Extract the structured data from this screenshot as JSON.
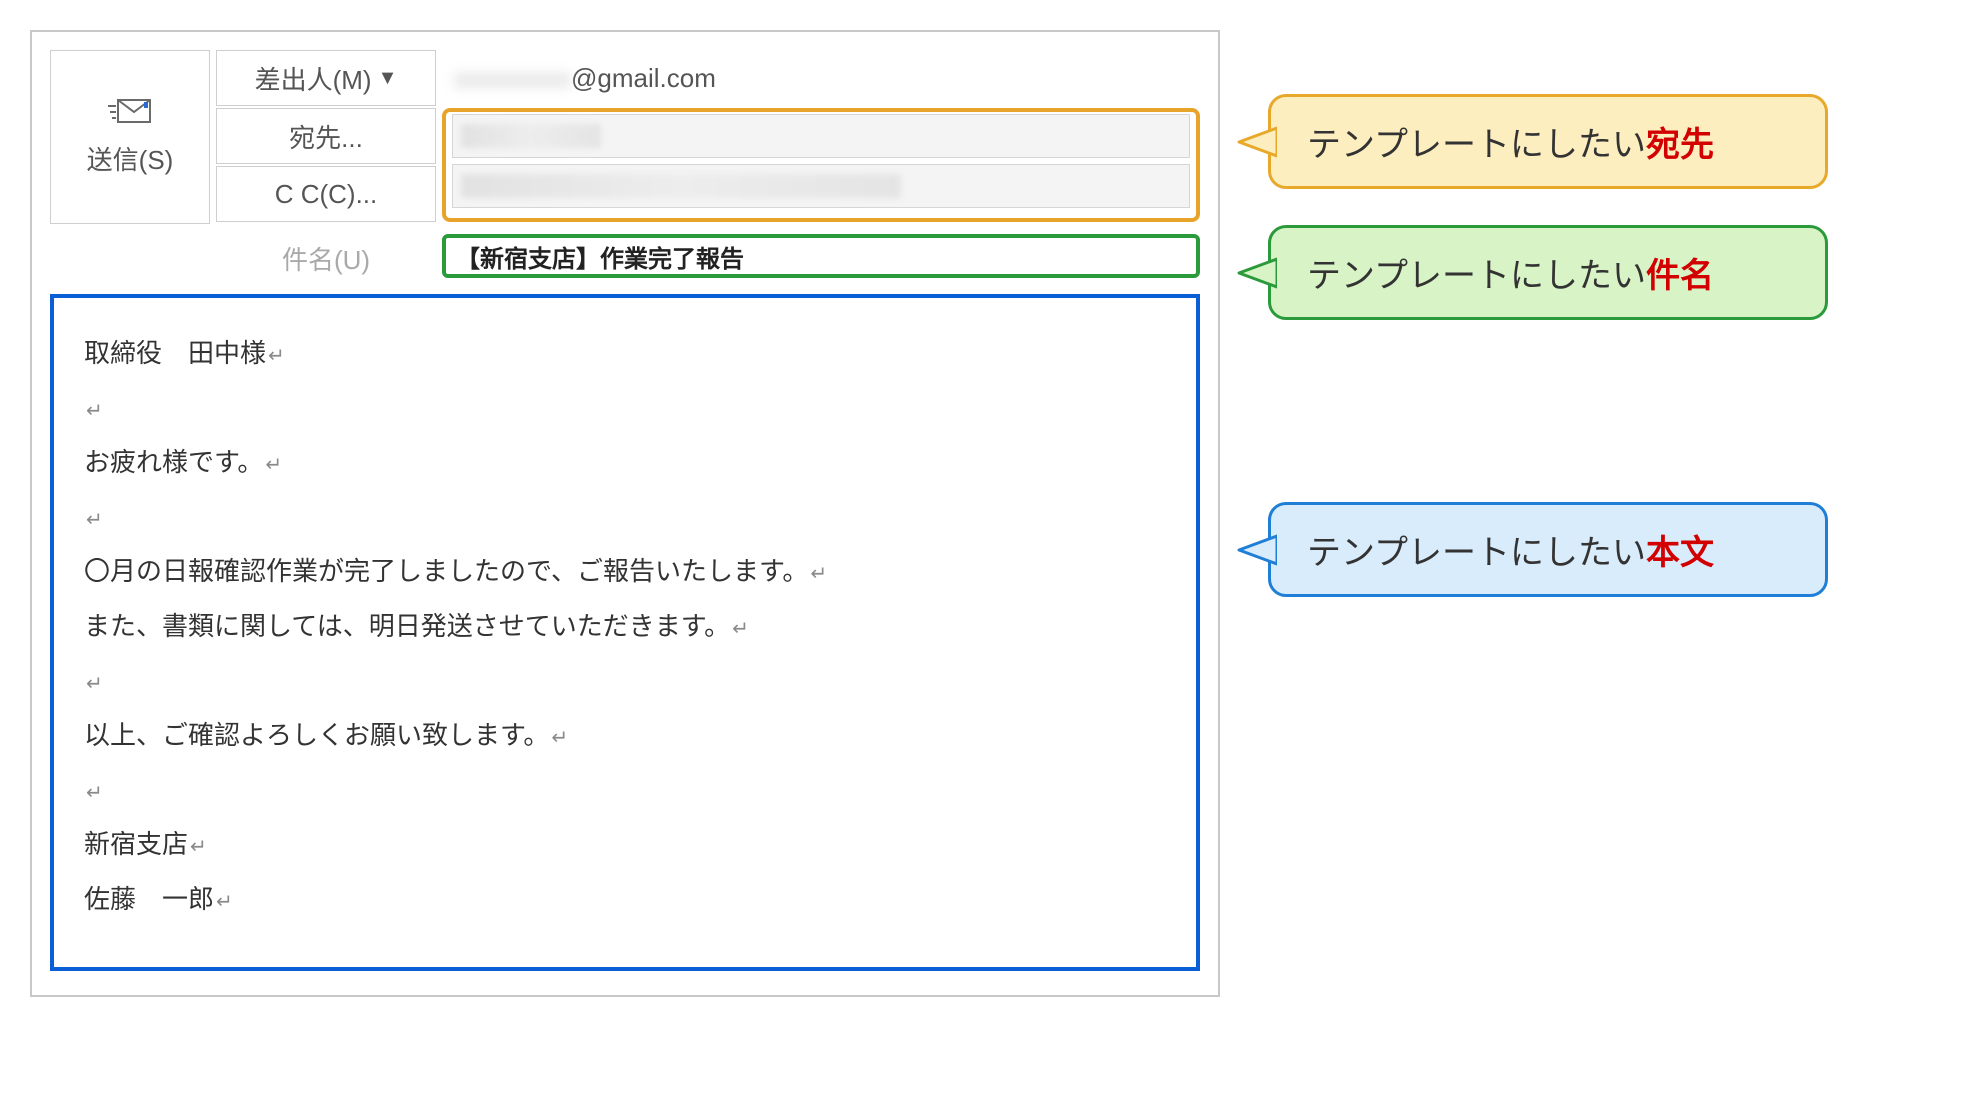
{
  "send": {
    "label": "送信(S)"
  },
  "fromBtn": "差出人(M)",
  "fromValue": "@gmail.com",
  "toBtn": "宛先...",
  "ccBtn": "C C(C)...",
  "subjectLabel": "件名(U)",
  "subjectValue": "【新宿支店】作業完了報告",
  "body": {
    "lines": [
      "取締役　田中様",
      "",
      "お疲れ様です。",
      "",
      "〇月の日報確認作業が完了しましたので、ご報告いたします。",
      "また、書類に関しては、明日発送させていただきます。",
      "",
      "以上、ご確認よろしくお願い致します。",
      "",
      "新宿支店",
      "佐藤　一郎"
    ]
  },
  "callouts": {
    "to": {
      "prefix": "テンプレートにしたい",
      "em": "宛先"
    },
    "subj": {
      "prefix": "テンプレートにしたい",
      "em": "件名"
    },
    "body": {
      "prefix": "テンプレートにしたい",
      "em": "本文"
    }
  },
  "colors": {
    "orange": "#e8a32a",
    "green": "#2a9a3a",
    "blue": "#0a5fd6"
  }
}
